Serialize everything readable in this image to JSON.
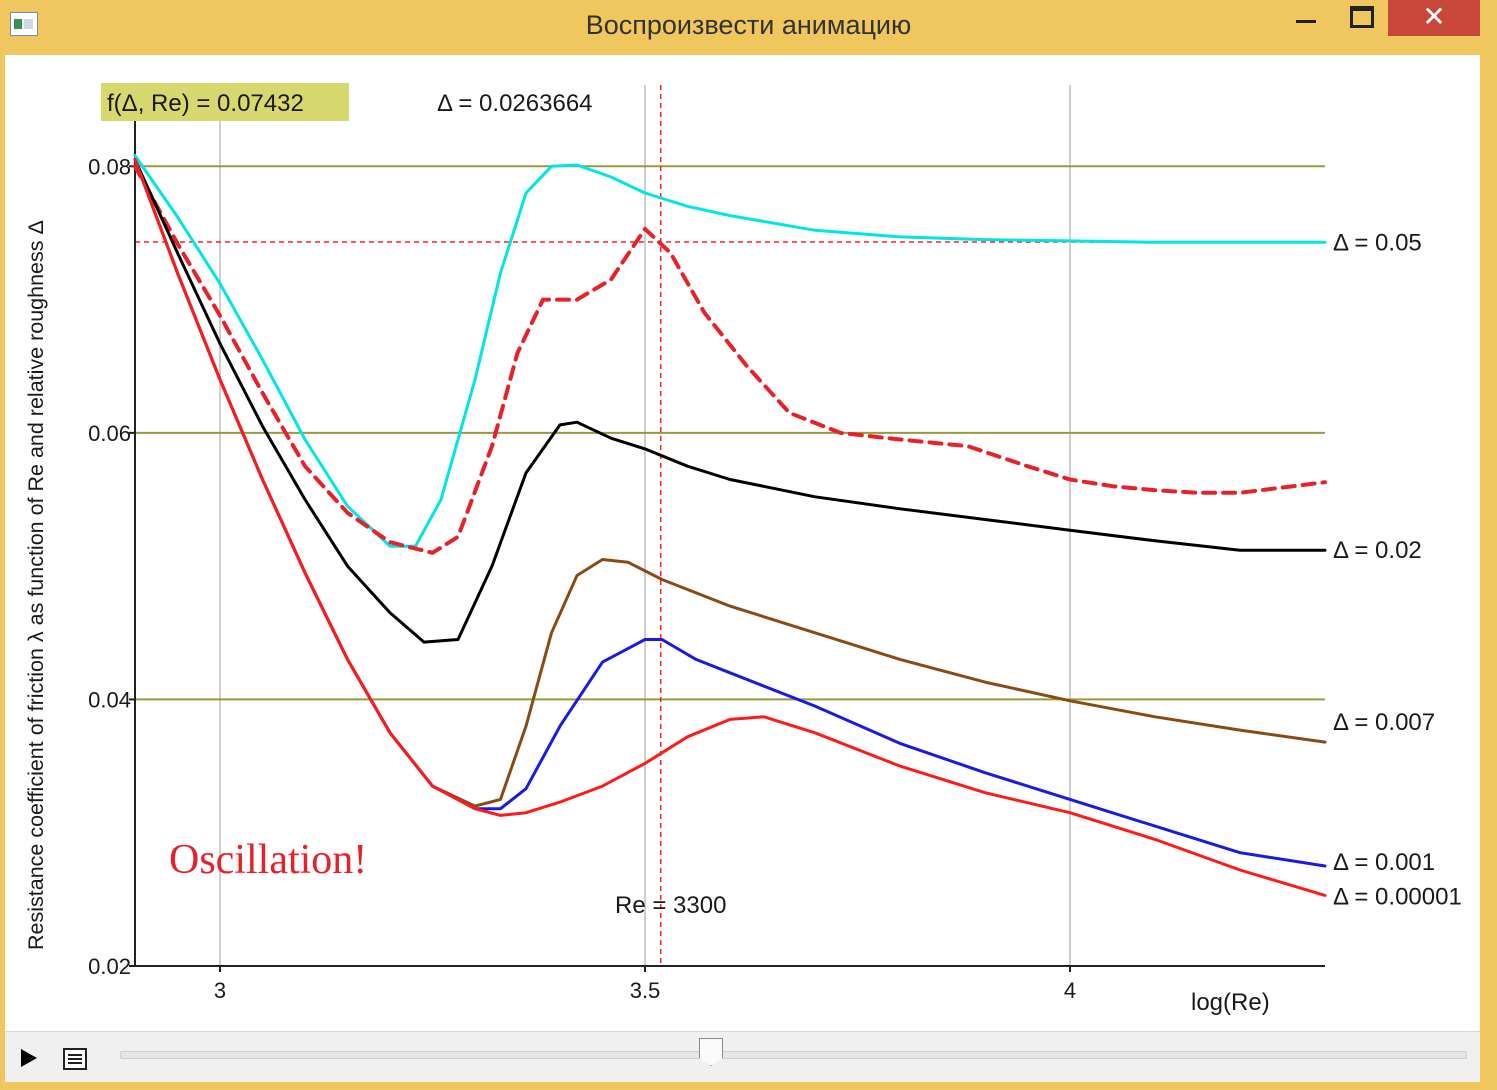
{
  "window": {
    "title": "Воспроизвести анимацию",
    "app_icon": "app-icon",
    "controls": {
      "minimize": "minimize-icon",
      "maximize": "maximize-icon",
      "close": "✕"
    }
  },
  "plot": {
    "f_box": "f(Δ, Re) = 0.07432",
    "delta_value": "Δ = 0.0263664",
    "re_label": "Re = 3300",
    "annotation": "Oscillation!",
    "colors": {
      "accent_box": "#d7d86e",
      "annotation": "#e8202a",
      "gridline_h": "#9a9a3a",
      "gridline_v": "#bdbdbd"
    }
  },
  "chart_data": {
    "type": "line",
    "xlabel": "log(Re)",
    "ylabel": "Resistance coefficient of friction λ as function of Re and relative roughness Δ",
    "xlim": [
      2.9,
      4.3
    ],
    "ylim": [
      0.02,
      0.087
    ],
    "x_ticks": [
      {
        "value": 3,
        "label": "3"
      },
      {
        "value": 3.5,
        "label": "3.5"
      },
      {
        "value": 4,
        "label": "4"
      }
    ],
    "y_ticks": [
      {
        "value": 0.02,
        "label": "0.02"
      },
      {
        "value": 0.04,
        "label": "0.04"
      },
      {
        "value": 0.06,
        "label": "0.06"
      },
      {
        "value": 0.08,
        "label": "0.08"
      }
    ],
    "hlines": [
      0.08,
      0.06,
      0.04
    ],
    "vlines": [
      3,
      3.5,
      4
    ],
    "markers": {
      "vline_x": 3.5185,
      "hline_y": 0.07432
    },
    "series": [
      {
        "name": "Δ = 0.05",
        "color": "#00e5e5",
        "width": 3,
        "dash": false,
        "points": [
          [
            2.9,
            0.0808
          ],
          [
            2.95,
            0.0762
          ],
          [
            3.0,
            0.0712
          ],
          [
            3.05,
            0.0655
          ],
          [
            3.1,
            0.0595
          ],
          [
            3.15,
            0.0545
          ],
          [
            3.2,
            0.0515
          ],
          [
            3.23,
            0.0515
          ],
          [
            3.26,
            0.055
          ],
          [
            3.3,
            0.064
          ],
          [
            3.33,
            0.072
          ],
          [
            3.36,
            0.078
          ],
          [
            3.39,
            0.08
          ],
          [
            3.42,
            0.0801
          ],
          [
            3.46,
            0.0792
          ],
          [
            3.5,
            0.078
          ],
          [
            3.55,
            0.077
          ],
          [
            3.6,
            0.0763
          ],
          [
            3.7,
            0.0752
          ],
          [
            3.8,
            0.0747
          ],
          [
            3.9,
            0.0745
          ],
          [
            4.0,
            0.0744
          ],
          [
            4.1,
            0.0743
          ],
          [
            4.2,
            0.0743
          ],
          [
            4.3,
            0.0743
          ]
        ]
      },
      {
        "name": "",
        "color": "#e8202a",
        "width": 4,
        "dash": true,
        "points": [
          [
            2.9,
            0.08
          ],
          [
            2.95,
            0.0742
          ],
          [
            3.0,
            0.0688
          ],
          [
            3.05,
            0.063
          ],
          [
            3.1,
            0.0575
          ],
          [
            3.15,
            0.054
          ],
          [
            3.2,
            0.0518
          ],
          [
            3.25,
            0.051
          ],
          [
            3.28,
            0.0522
          ],
          [
            3.32,
            0.059
          ],
          [
            3.35,
            0.066
          ],
          [
            3.38,
            0.07
          ],
          [
            3.42,
            0.07
          ],
          [
            3.46,
            0.0715
          ],
          [
            3.5,
            0.0753
          ],
          [
            3.53,
            0.0735
          ],
          [
            3.57,
            0.069
          ],
          [
            3.62,
            0.065
          ],
          [
            3.67,
            0.0615
          ],
          [
            3.73,
            0.06
          ],
          [
            3.8,
            0.0595
          ],
          [
            3.88,
            0.059
          ],
          [
            3.95,
            0.0575
          ],
          [
            4.0,
            0.0565
          ],
          [
            4.05,
            0.056
          ],
          [
            4.1,
            0.0557
          ],
          [
            4.15,
            0.0555
          ],
          [
            4.2,
            0.0555
          ],
          [
            4.3,
            0.0563
          ]
        ]
      },
      {
        "name": "Δ = 0.02",
        "color": "#000000",
        "width": 3,
        "dash": false,
        "points": [
          [
            2.9,
            0.0805
          ],
          [
            2.95,
            0.0735
          ],
          [
            3.0,
            0.0667
          ],
          [
            3.05,
            0.0605
          ],
          [
            3.1,
            0.055
          ],
          [
            3.15,
            0.05
          ],
          [
            3.2,
            0.0465
          ],
          [
            3.24,
            0.0443
          ],
          [
            3.28,
            0.0445
          ],
          [
            3.32,
            0.05
          ],
          [
            3.36,
            0.057
          ],
          [
            3.4,
            0.0606
          ],
          [
            3.42,
            0.0608
          ],
          [
            3.46,
            0.0596
          ],
          [
            3.5,
            0.0588
          ],
          [
            3.55,
            0.0575
          ],
          [
            3.6,
            0.0565
          ],
          [
            3.7,
            0.0552
          ],
          [
            3.8,
            0.0543
          ],
          [
            3.9,
            0.0535
          ],
          [
            4.0,
            0.0527
          ],
          [
            4.1,
            0.0519
          ],
          [
            4.2,
            0.0512
          ],
          [
            4.3,
            0.0512
          ]
        ]
      },
      {
        "name": "Δ = 0.007",
        "color": "#8b4a13",
        "width": 3,
        "dash": false,
        "points": [
          [
            2.9,
            0.0805
          ],
          [
            2.95,
            0.072
          ],
          [
            3.0,
            0.064
          ],
          [
            3.05,
            0.0565
          ],
          [
            3.1,
            0.0495
          ],
          [
            3.15,
            0.043
          ],
          [
            3.2,
            0.0375
          ],
          [
            3.25,
            0.0335
          ],
          [
            3.3,
            0.032
          ],
          [
            3.33,
            0.0325
          ],
          [
            3.36,
            0.038
          ],
          [
            3.39,
            0.045
          ],
          [
            3.42,
            0.0493
          ],
          [
            3.45,
            0.0505
          ],
          [
            3.48,
            0.0503
          ],
          [
            3.52,
            0.049
          ],
          [
            3.6,
            0.047
          ],
          [
            3.7,
            0.045
          ],
          [
            3.8,
            0.043
          ],
          [
            3.9,
            0.0413
          ],
          [
            4.0,
            0.0399
          ],
          [
            4.1,
            0.0387
          ],
          [
            4.2,
            0.0377
          ],
          [
            4.3,
            0.0368
          ]
        ]
      },
      {
        "name": "Δ = 0.001",
        "color": "#1a1ae6",
        "width": 3,
        "dash": false,
        "points": [
          [
            2.9,
            0.0805
          ],
          [
            2.95,
            0.072
          ],
          [
            3.0,
            0.064
          ],
          [
            3.05,
            0.0565
          ],
          [
            3.1,
            0.0495
          ],
          [
            3.15,
            0.043
          ],
          [
            3.2,
            0.0375
          ],
          [
            3.25,
            0.0335
          ],
          [
            3.3,
            0.0318
          ],
          [
            3.33,
            0.0318
          ],
          [
            3.36,
            0.0333
          ],
          [
            3.4,
            0.038
          ],
          [
            3.45,
            0.0428
          ],
          [
            3.5,
            0.0445
          ],
          [
            3.52,
            0.0445
          ],
          [
            3.56,
            0.043
          ],
          [
            3.6,
            0.042
          ],
          [
            3.7,
            0.0395
          ],
          [
            3.8,
            0.0367
          ],
          [
            3.9,
            0.0345
          ],
          [
            4.0,
            0.0325
          ],
          [
            4.1,
            0.0305
          ],
          [
            4.2,
            0.0285
          ],
          [
            4.3,
            0.0275
          ]
        ]
      },
      {
        "name": "Δ = 0.00001",
        "color": "#ff1a1a",
        "width": 3,
        "dash": false,
        "points": [
          [
            2.9,
            0.0805
          ],
          [
            2.95,
            0.072
          ],
          [
            3.0,
            0.064
          ],
          [
            3.05,
            0.0565
          ],
          [
            3.1,
            0.0495
          ],
          [
            3.15,
            0.043
          ],
          [
            3.2,
            0.0375
          ],
          [
            3.25,
            0.0335
          ],
          [
            3.3,
            0.0318
          ],
          [
            3.33,
            0.0313
          ],
          [
            3.36,
            0.0315
          ],
          [
            3.4,
            0.0323
          ],
          [
            3.45,
            0.0335
          ],
          [
            3.5,
            0.0352
          ],
          [
            3.55,
            0.0372
          ],
          [
            3.6,
            0.0385
          ],
          [
            3.64,
            0.0387
          ],
          [
            3.7,
            0.0375
          ],
          [
            3.8,
            0.035
          ],
          [
            3.9,
            0.033
          ],
          [
            4.0,
            0.0315
          ],
          [
            4.1,
            0.0295
          ],
          [
            4.2,
            0.0272
          ],
          [
            4.3,
            0.0253
          ]
        ]
      }
    ],
    "legend": [
      {
        "label": "Δ = 0.05",
        "y": 0.0743
      },
      {
        "label": "Δ = 0.02",
        "y": 0.0512
      },
      {
        "label": "Δ = 0.007",
        "y": 0.0383
      },
      {
        "label": "Δ = 0.001",
        "y": 0.0278
      },
      {
        "label": "Δ = 0.00001",
        "y": 0.0252
      }
    ]
  },
  "player": {
    "play_icon": "play-icon",
    "options_icon": "options-icon",
    "slider_position": 0.445
  }
}
